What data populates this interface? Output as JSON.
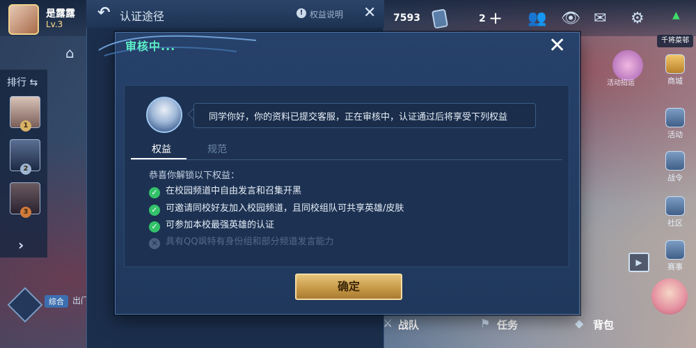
{
  "player": {
    "name": "是露露",
    "level": "Lv.3",
    "coins": "7593",
    "tickets": "2"
  },
  "right_banner": "千将菜邨",
  "event_label": "活动招运",
  "ranking": {
    "title": "排行 ⇆",
    "badges": [
      "1",
      "2",
      "3"
    ]
  },
  "bottom_left": {
    "tag": "综合",
    "text": "出门"
  },
  "right_menu": [
    "商城",
    "活动",
    "战令",
    "社区",
    "赛事"
  ],
  "bottom_menu": {
    "team": "战队",
    "tasks": "任务",
    "bag": "背包"
  },
  "under_window": {
    "title": "认证途径",
    "rights_link": "权益说明"
  },
  "modal": {
    "title": "审核中...",
    "close_glyph": "✕",
    "message": "同学你好，你的资料已提交客服，正在审核中，认证通过后将享受下列权益",
    "tabs": [
      {
        "label": "权益",
        "active": true
      },
      {
        "label": "规范",
        "active": false
      }
    ],
    "intro": "恭喜你解锁以下权益：",
    "benefits": [
      {
        "text": "在校园频道中自由发言和召集开黑",
        "unlocked": true
      },
      {
        "text": "可邀请同校好友加入校园频道，且同校组队可共享英雄/皮肤",
        "unlocked": true
      },
      {
        "text": "可参加本校最强英雄的认证",
        "unlocked": true
      },
      {
        "text": "具有QQ飒特有身份组和部分频道发言能力",
        "unlocked": false
      }
    ],
    "confirm_label": "确定"
  },
  "colors": {
    "title_green": "#5cf0c6",
    "check_green": "#33c26a",
    "button_gold": "#c79a49",
    "panel_bg": "#20385c"
  }
}
